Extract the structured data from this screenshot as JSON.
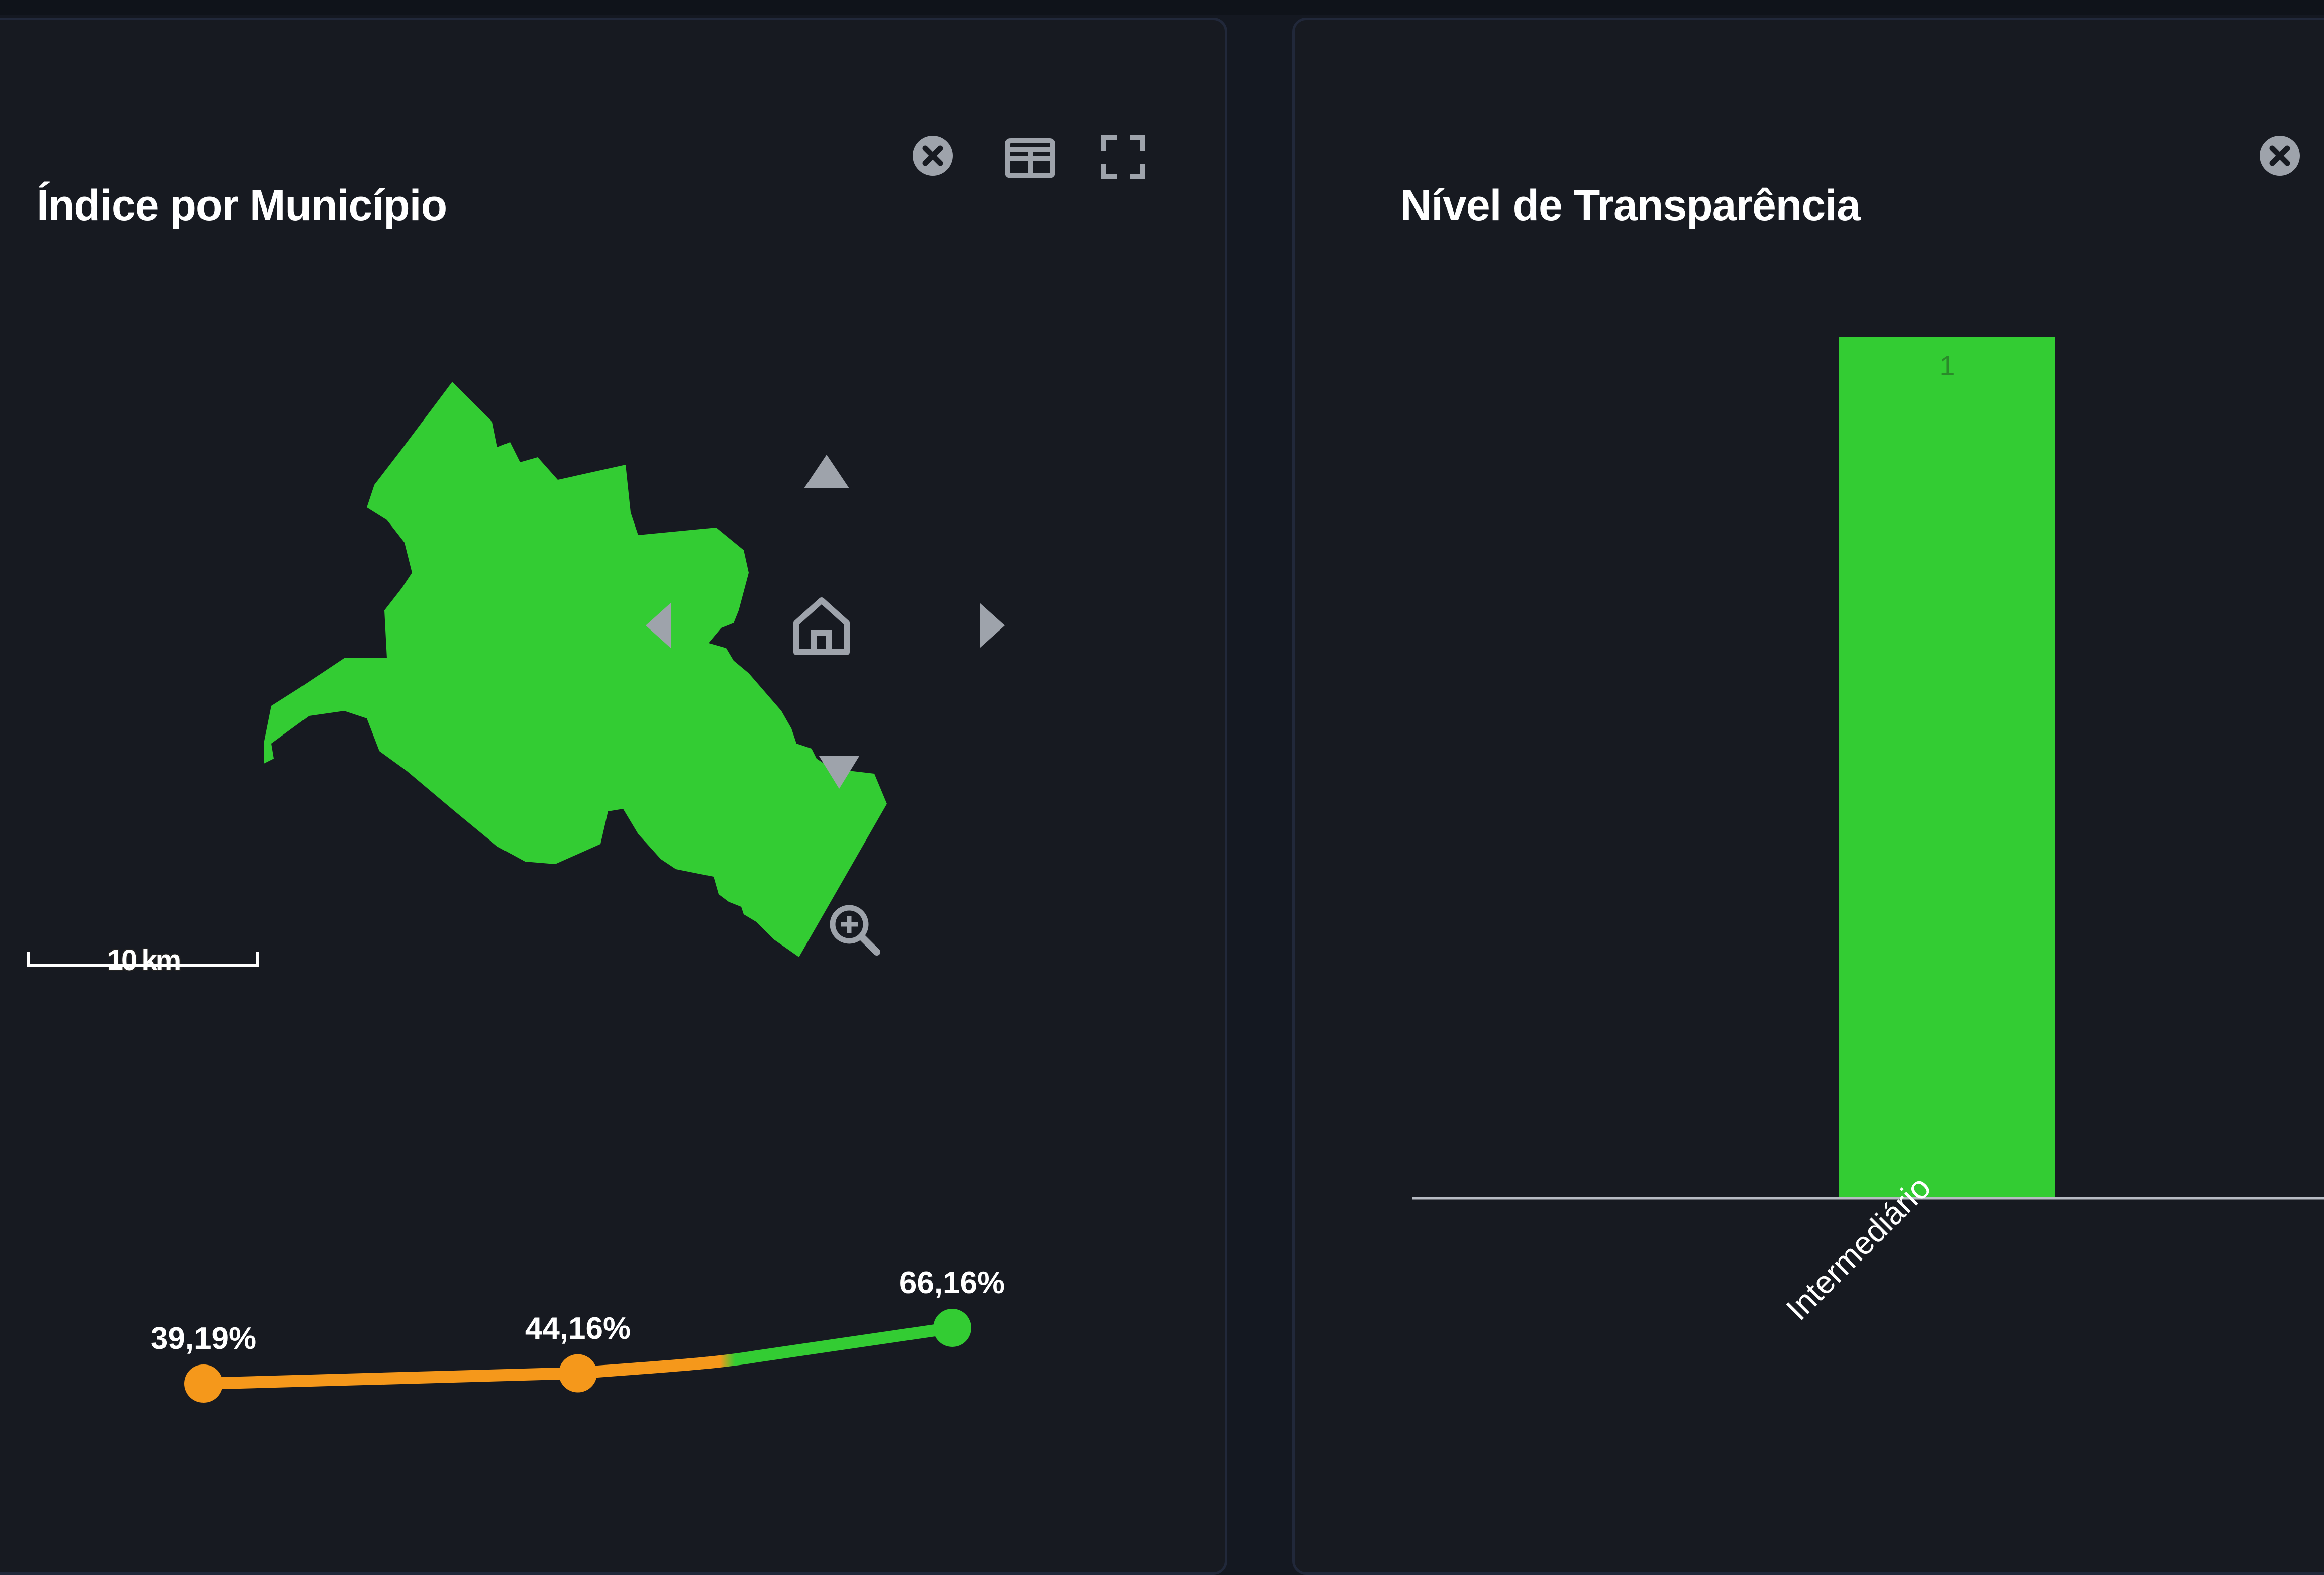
{
  "left_panel": {
    "title": "Índice por Município",
    "toolbar": [
      {
        "name": "close-icon"
      },
      {
        "name": "table-icon"
      },
      {
        "name": "fullscreen-icon"
      }
    ],
    "map": {
      "fill_color": "#33cc33",
      "scale_label": "10 km",
      "nav_controls": [
        "arrow-up-icon",
        "arrow-left-icon",
        "home-icon",
        "arrow-right-icon",
        "arrow-down-icon",
        "zoom-in-icon"
      ]
    },
    "trend": {
      "points": [
        {
          "label": "39,19%",
          "value": 39.19,
          "color": "#f5981b"
        },
        {
          "label": "44,16%",
          "value": 44.16,
          "color": "#f5981b"
        },
        {
          "label": "66,16%",
          "value": 66.16,
          "color": "#33cc33"
        }
      ]
    }
  },
  "right_panel": {
    "title": "Nível de Transparência",
    "toolbar": [
      {
        "name": "close-icon"
      }
    ]
  },
  "chart_data": {
    "type": "bar",
    "categories": [
      "Intermediário"
    ],
    "values": [
      1
    ],
    "data_labels": [
      "1"
    ],
    "title": "Nível de Transparência",
    "ylim": [
      0,
      1.2
    ],
    "grid": false,
    "bar_color": "#33cc33"
  },
  "colors": {
    "background": "#141821",
    "panel": "#171a21",
    "panel_border": "#21283a",
    "accent_green": "#33cc33",
    "accent_orange": "#f5981b",
    "icon_gray": "#9ea3ab"
  }
}
